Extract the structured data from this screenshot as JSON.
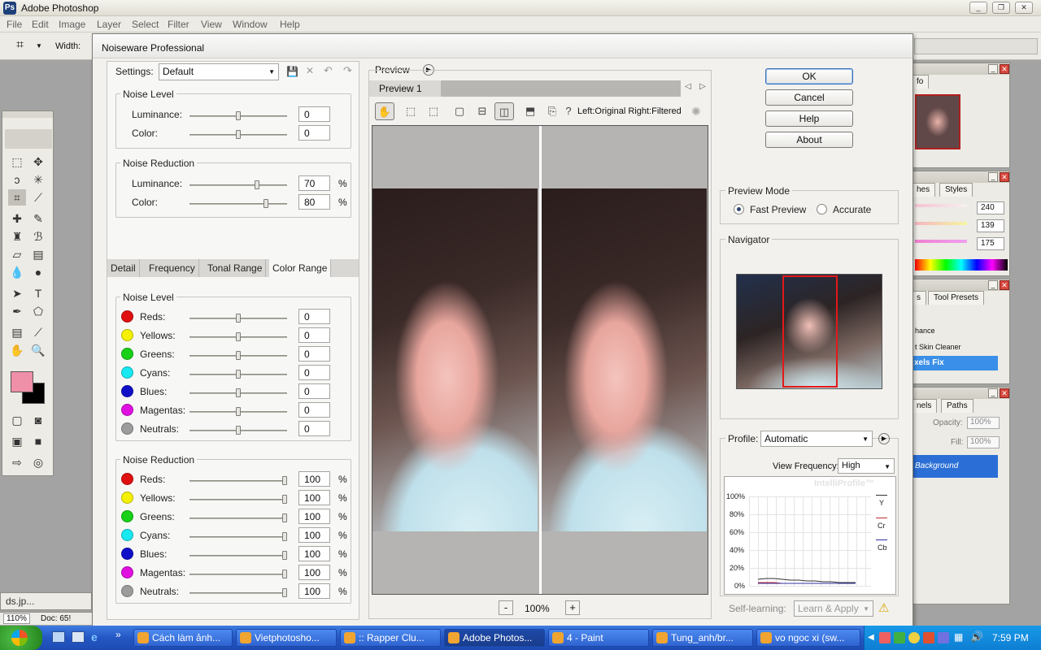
{
  "app": {
    "title": "Adobe Photoshop",
    "menus": [
      "File",
      "Edit",
      "Image",
      "Layer",
      "Select",
      "Filter",
      "View",
      "Window",
      "Help"
    ],
    "options_width_label": "Width:"
  },
  "palettes": {
    "info_tab": "fo",
    "color_tabs": [
      "hes",
      "Styles"
    ],
    "color_values": [
      "240",
      "139",
      "175"
    ],
    "tool_presets_tabs": [
      "s",
      "Tool Presets"
    ],
    "tool_presets_items": [
      "hance",
      "t Skin Cleaner",
      "xels Fix"
    ],
    "layers_tabs": [
      "nels",
      "Paths"
    ],
    "opacity_label": "Opacity:",
    "opacity_value": "100%",
    "fill_label": "Fill:",
    "fill_value": "100%",
    "layer_name": "Background"
  },
  "doc": {
    "tab": "ds.jp...",
    "zoom": "110%",
    "doc_label": "Doc: 65!"
  },
  "dialog": {
    "title": "Noiseware Professional",
    "settings_label": "Settings:",
    "settings_value": "Default",
    "noise_level_title": "Noise Level",
    "noise_reduction_title": "Noise Reduction",
    "luminance_label": "Luminance:",
    "color_label": "Color:",
    "nl_luminance": "0",
    "nl_color": "0",
    "nl_luminance_pos": 0.5,
    "nl_color_pos": 0.5,
    "nr_luminance": "70",
    "nr_color": "80",
    "nr_luminance_pos": 0.7,
    "nr_color_pos": 0.8,
    "pct": "%",
    "tabs": [
      "Detail",
      "Frequency",
      "Tonal Range",
      "Color Range"
    ],
    "cr_noise_level_title": "Noise Level",
    "cr_noise_reduction_title": "Noise Reduction",
    "colors": [
      {
        "name": "Reds:",
        "swatch": "#e01010",
        "level": "0",
        "level_pos": 0.5,
        "reduction": "100",
        "reduction_pos": 1.0
      },
      {
        "name": "Yellows:",
        "swatch": "#f4f000",
        "level": "0",
        "level_pos": 0.5,
        "reduction": "100",
        "reduction_pos": 1.0
      },
      {
        "name": "Greens:",
        "swatch": "#18d018",
        "level": "0",
        "level_pos": 0.5,
        "reduction": "100",
        "reduction_pos": 1.0
      },
      {
        "name": "Cyans:",
        "swatch": "#18e8f0",
        "level": "0",
        "level_pos": 0.5,
        "reduction": "100",
        "reduction_pos": 1.0
      },
      {
        "name": "Blues:",
        "swatch": "#1010c8",
        "level": "0",
        "level_pos": 0.5,
        "reduction": "100",
        "reduction_pos": 1.0
      },
      {
        "name": "Magentas:",
        "swatch": "#e010e0",
        "level": "0",
        "level_pos": 0.5,
        "reduction": "100",
        "reduction_pos": 1.0
      },
      {
        "name": "Neutrals:",
        "swatch": "#9c9c9c",
        "level": "0",
        "level_pos": 0.5,
        "reduction": "100",
        "reduction_pos": 1.0
      }
    ],
    "preview_label": "Preview",
    "preview_tab": "Preview 1",
    "preview_caption": "Left:Original Right:Filtered",
    "zoom": "100%",
    "buttons": {
      "ok": "OK",
      "cancel": "Cancel",
      "help": "Help",
      "about": "About"
    },
    "preview_mode_title": "Preview Mode",
    "preview_mode_options": [
      "Fast Preview",
      "Accurate"
    ],
    "preview_mode_selected": "Fast Preview",
    "navigator_title": "Navigator",
    "profile_label": "Profile:",
    "profile_value": "Automatic",
    "view_frequency_label": "View Frequency:",
    "view_frequency_value": "High",
    "graph_watermark": "IntelliProfile™",
    "graph_yticks": [
      "100%",
      "80%",
      "60%",
      "40%",
      "20%",
      "0%"
    ],
    "graph_legend": [
      "Y",
      "Cr",
      "Cb"
    ],
    "self_learning_label": "Self-learning:",
    "self_learning_value": "Learn & Apply"
  },
  "taskbar": {
    "items": [
      "Cách làm ảnh...",
      "Vietphotosho...",
      ":: Rapper Clu...",
      "Adobe Photos...",
      "4 - Paint",
      "Tung_anh/br...",
      "vo ngoc xi (sw..."
    ],
    "active_item": "Adobe Photos...",
    "clock": "7:59 PM"
  }
}
